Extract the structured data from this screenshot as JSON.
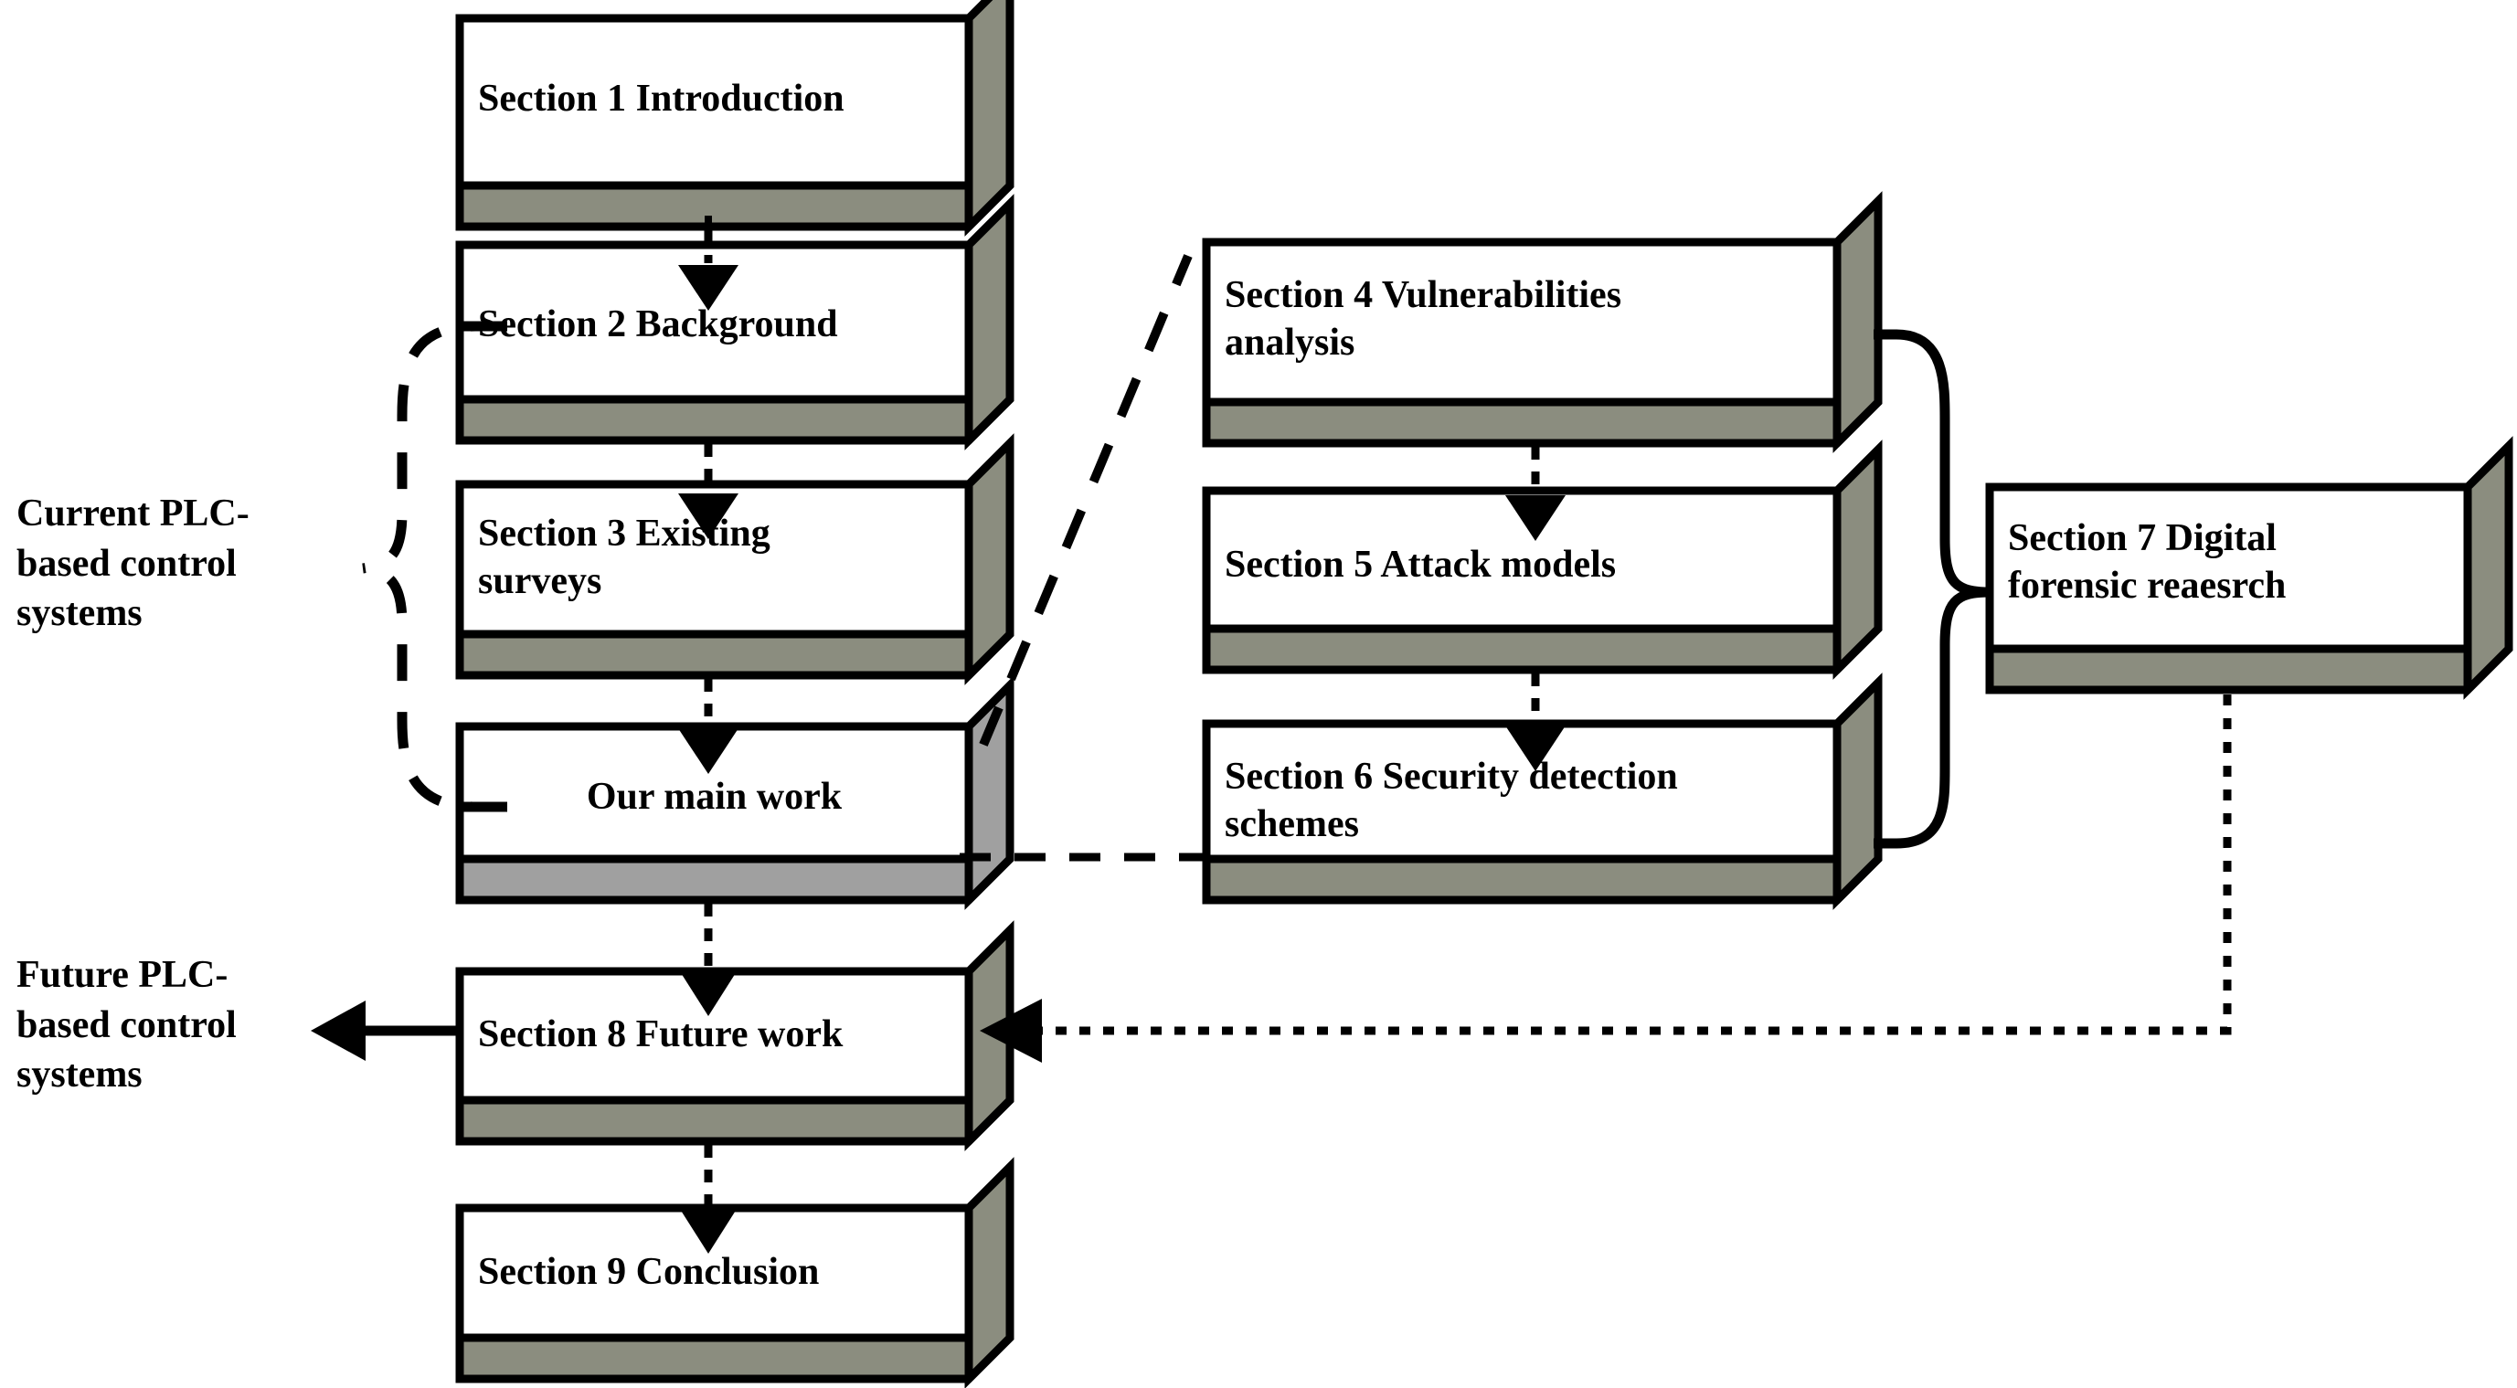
{
  "diagram": {
    "title": "Paper organization flowchart",
    "colors": {
      "box_fill": "#ffffff",
      "box_border": "#000000",
      "box_shadow": "#8b8d7f",
      "box_shadow_light": "#a0a0a0",
      "background": "#ffffff"
    },
    "boxes": [
      {
        "id": "sec1",
        "label": "Section 1 Introduction",
        "align": "left"
      },
      {
        "id": "sec2",
        "label": "Section 2 Background",
        "align": "left"
      },
      {
        "id": "sec3",
        "label": "Section 3 Existing\nsurveys",
        "align": "left"
      },
      {
        "id": "main",
        "label": "Our main work",
        "align": "center"
      },
      {
        "id": "sec8",
        "label": "Section 8 Future work",
        "align": "left"
      },
      {
        "id": "sec9",
        "label": "Section 9 Conclusion",
        "align": "left"
      },
      {
        "id": "sec4",
        "label": "Section 4 Vulnerabilities\nanalysis",
        "align": "left"
      },
      {
        "id": "sec5",
        "label": "Section 5 Attack models",
        "align": "left"
      },
      {
        "id": "sec6",
        "label": "Section 6 Security detection\nschemes",
        "align": "left"
      },
      {
        "id": "sec7",
        "label": "Section 7 Digital\nforensic reaesrch",
        "align": "left"
      }
    ],
    "side_labels": [
      {
        "id": "current-plc",
        "label": "Current PLC-\nbased control\nsystems"
      },
      {
        "id": "future-plc",
        "label": "Future PLC-\nbased control\nsystems"
      }
    ],
    "connectors": [
      {
        "id": "sec1-to-sec2",
        "style": "dashed-arrow",
        "from": "sec1",
        "to": "sec2"
      },
      {
        "id": "sec2-to-sec3",
        "style": "dashed-arrow",
        "from": "sec2",
        "to": "sec3"
      },
      {
        "id": "sec3-to-main",
        "style": "dashed-arrow",
        "from": "sec3",
        "to": "main"
      },
      {
        "id": "main-to-sec8",
        "style": "dashed-arrow",
        "from": "main",
        "to": "sec8"
      },
      {
        "id": "sec8-to-sec9",
        "style": "dashed-arrow",
        "from": "sec8",
        "to": "sec9"
      },
      {
        "id": "sec4-to-sec5",
        "style": "dashed-arrow",
        "from": "sec4",
        "to": "sec5"
      },
      {
        "id": "sec5-to-sec6",
        "style": "dashed-arrow",
        "from": "sec5",
        "to": "sec6"
      },
      {
        "id": "main-to-sec4",
        "style": "dashed-diagonal",
        "from": "main",
        "to": "sec4"
      },
      {
        "id": "main-to-sec6",
        "style": "dashed-horizontal",
        "from": "main",
        "to": "sec6"
      },
      {
        "id": "sec7-to-sec8",
        "style": "dotted-arrow",
        "from": "sec7",
        "to": "sec8"
      },
      {
        "id": "current-plc-brace",
        "style": "dashed-brace",
        "from": "sec2-main-group",
        "to": "current-plc"
      },
      {
        "id": "sec46-to-sec7-brace",
        "style": "solid-brace",
        "from": "sec4-sec6-group",
        "to": "sec7"
      },
      {
        "id": "sec8-to-future-plc",
        "style": "solid-arrow",
        "from": "sec8",
        "to": "future-plc"
      }
    ]
  }
}
